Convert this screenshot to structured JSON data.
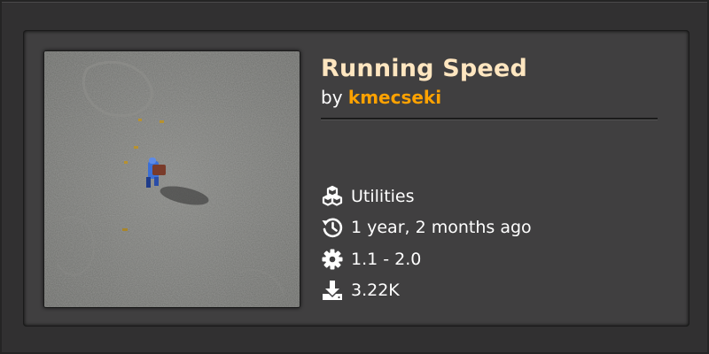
{
  "mod": {
    "title": "Running Speed",
    "by_prefix": "by",
    "author": "kmecseki",
    "thumbnail_alt": "Running Speed thumbnail"
  },
  "meta": {
    "category": {
      "icon": "cubes-icon",
      "label": "Utilities"
    },
    "updated": {
      "icon": "history-icon",
      "label": "1 year, 2 months ago"
    },
    "version": {
      "icon": "gear-icon",
      "label": "1.1 - 2.0"
    },
    "downloads": {
      "icon": "download-icon",
      "label": "3.22K"
    }
  },
  "colors": {
    "title": "#ffe6c0",
    "author": "#ffa200",
    "card_bg": "#403f40",
    "page_bg": "#313031"
  }
}
